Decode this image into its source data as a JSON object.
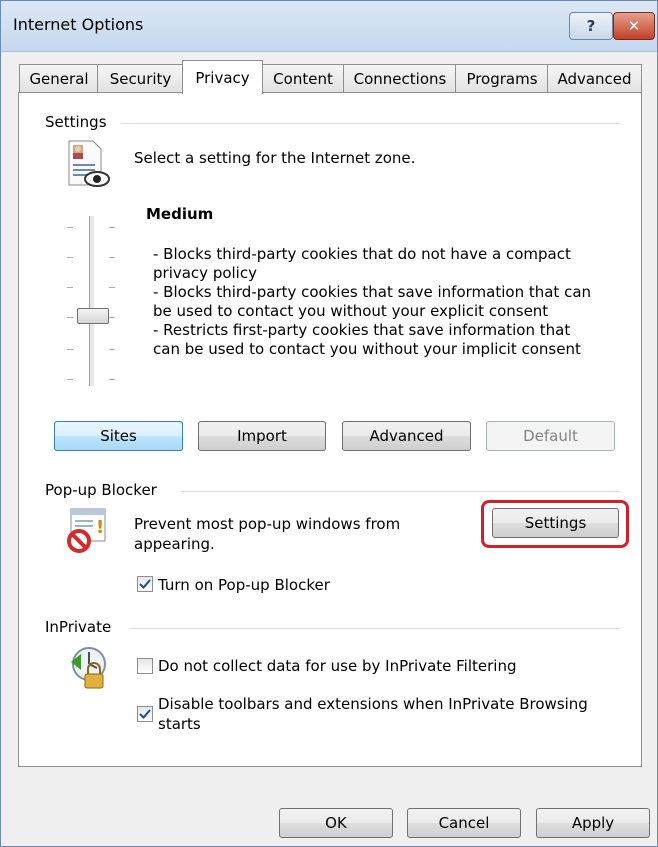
{
  "window": {
    "title": "Internet Options"
  },
  "titlebar": {
    "help_label": "?",
    "close_label": "✕"
  },
  "tabs": [
    "General",
    "Security",
    "Privacy",
    "Content",
    "Connections",
    "Programs",
    "Advanced"
  ],
  "active_tab": "Privacy",
  "settings": {
    "group_title": "Settings",
    "zone_text": "Select a setting for the Internet zone.",
    "level_title": "Medium",
    "level_description": [
      "- Blocks third-party cookies that do not have a compact",
      "privacy policy",
      "- Blocks third-party cookies that save information that can",
      "be used to contact you without your explicit consent",
      "- Restricts first-party cookies that save information that",
      "can be used to contact you without your implicit consent"
    ],
    "buttons": {
      "sites": "Sites",
      "import": "Import",
      "advanced": "Advanced",
      "default": "Default"
    }
  },
  "popup_blocker": {
    "group_title": "Pop-up Blocker",
    "description_line1": "Prevent most pop-up windows from",
    "description_line2": "appearing.",
    "settings_button": "Settings",
    "turn_on_label": "Turn on Pop-up Blocker",
    "turn_on_checked": true
  },
  "inprivate": {
    "group_title": "InPrivate",
    "filtering_label": "Do not collect data for use by InPrivate Filtering",
    "filtering_checked": false,
    "disable_toolbars_line1": "Disable toolbars and extensions when InPrivate Browsing",
    "disable_toolbars_line2": "starts",
    "disable_toolbars_checked": true
  },
  "footer": {
    "ok": "OK",
    "cancel": "Cancel",
    "apply": "Apply"
  },
  "colors": {
    "highlight": "#d0202a",
    "focus_border": "#3c7fb1"
  }
}
